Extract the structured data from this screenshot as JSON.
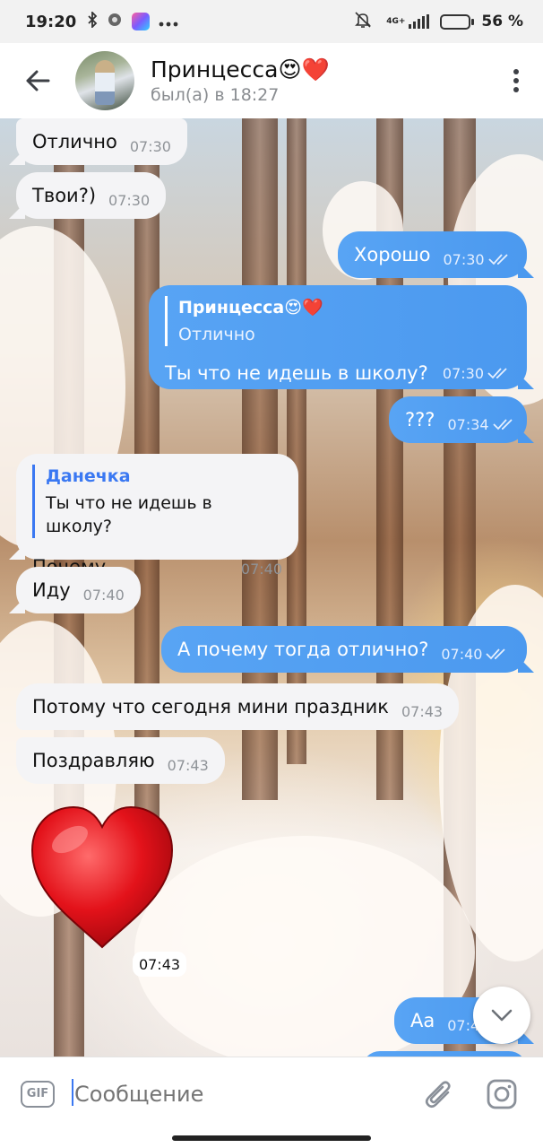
{
  "status_bar": {
    "time": "19:20",
    "battery_percent": "56 %",
    "battery_level": 56,
    "network": "4G+"
  },
  "header": {
    "name": "Принцесса😍❤️",
    "status": "был(а) в 18:27"
  },
  "messages": [
    {
      "dir": "in",
      "text": "Отлично",
      "time": "07:30"
    },
    {
      "dir": "in",
      "text": "Твои?)",
      "time": "07:30"
    },
    {
      "dir": "out",
      "text": "Хорошо",
      "time": "07:30"
    },
    {
      "dir": "out",
      "reply_to_name": "Принцесса😍❤️",
      "reply_to_text": "Отлично",
      "text": "Ты что не идешь в школу?",
      "time": "07:30"
    },
    {
      "dir": "out",
      "text": "???",
      "time": "07:34"
    },
    {
      "dir": "in",
      "reply_to_name": "Данечка",
      "reply_to_text": "Ты что не идешь в школу?",
      "text": "Почему",
      "time": "07:40"
    },
    {
      "dir": "in",
      "text": "Иду",
      "time": "07:40"
    },
    {
      "dir": "out",
      "text": "А почему тогда отлично?",
      "time": "07:40"
    },
    {
      "dir": "in",
      "text": "Потому что сегодня мини праздник",
      "time": "07:43"
    },
    {
      "dir": "in",
      "text": "Поздравляю",
      "time": "07:43"
    },
    {
      "dir": "in",
      "sticker": "red-heart",
      "time": "07:43"
    },
    {
      "dir": "out",
      "text": "Аа",
      "time": "07:4"
    }
  ],
  "composer": {
    "gif_label": "GIF",
    "placeholder": "Сообщение"
  },
  "colors": {
    "outgoing_bubble": "#4b99ef",
    "incoming_bubble": "#f4f4f6",
    "quote_accent": "#3a78f2"
  }
}
